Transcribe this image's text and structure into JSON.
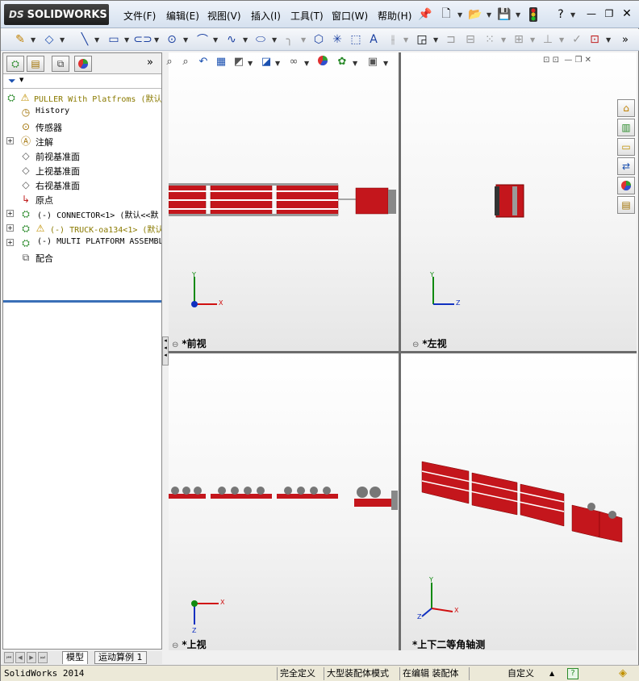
{
  "app": {
    "logo_text": "SOLIDWORKS",
    "logo_prefix": "DS"
  },
  "menu": {
    "items": [
      "文件(F)",
      "编辑(E)",
      "视图(V)",
      "插入(I)",
      "工具(T)",
      "窗口(W)",
      "帮助(H)"
    ]
  },
  "feature_tree": {
    "root": "PULLER With Platfroms  (默认",
    "items": [
      {
        "label": "History",
        "icon": "history-icon"
      },
      {
        "label": "传感器",
        "icon": "sensor-icon"
      },
      {
        "label": "注解",
        "icon": "annotation-icon"
      },
      {
        "label": "前视基准面",
        "icon": "plane-icon"
      },
      {
        "label": "上视基准面",
        "icon": "plane-icon"
      },
      {
        "label": "右视基准面",
        "icon": "plane-icon"
      },
      {
        "label": "原点",
        "icon": "origin-icon"
      },
      {
        "label": "(-) CONNECTOR<1> (默认<<默",
        "icon": "assembly-icon"
      },
      {
        "label": "(-) TRUCK-oa134<1> (默认",
        "icon": "assembly-warning-icon"
      },
      {
        "label": "(-) MULTI PLATFORM ASSEMBL",
        "icon": "assembly-icon"
      },
      {
        "label": "配合",
        "icon": "mates-icon"
      }
    ]
  },
  "viewports": {
    "front": "*前视",
    "left": "*左视",
    "top": "*上视",
    "iso": "*上下二等角轴测"
  },
  "triad": {
    "x": "X",
    "y": "Y",
    "z": "Z"
  },
  "bottom_tabs": {
    "model": "模型",
    "motion": "运动算例 1"
  },
  "status": {
    "version": "SolidWorks 2014",
    "defined": "完全定义",
    "large_assembly": "大型装配体模式",
    "editing": "在编辑 装配体",
    "custom": "自定义"
  },
  "colors": {
    "model_red": "#c4161c",
    "axis_x": "#d01010",
    "axis_y": "#108a10",
    "axis_z": "#1030c0"
  }
}
